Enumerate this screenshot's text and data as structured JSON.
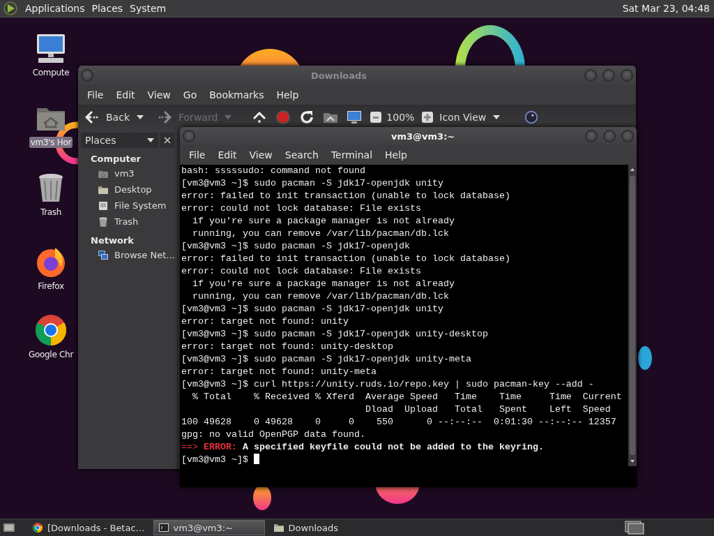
{
  "top_panel": {
    "menus": [
      "Applications",
      "Places",
      "System"
    ],
    "clock": "Sat Mar 23, 04:48"
  },
  "desktop_icons": [
    {
      "label": "Compute",
      "kind": "computer",
      "selected": false
    },
    {
      "label": "vm3's Hor",
      "kind": "home",
      "selected": true
    },
    {
      "label": "Trash",
      "kind": "trash",
      "selected": false
    },
    {
      "label": "Firefox",
      "kind": "firefox",
      "selected": false
    },
    {
      "label": "Google Chr",
      "kind": "chrome",
      "selected": false
    }
  ],
  "file_manager": {
    "title": "Downloads",
    "menu": [
      "File",
      "Edit",
      "View",
      "Go",
      "Bookmarks",
      "Help"
    ],
    "toolbar": {
      "back": "Back",
      "forward": "Forward",
      "forward_disabled": true,
      "zoom": "100%",
      "view_mode": "Icon View"
    },
    "sidebar": {
      "header": "Places",
      "sections": [
        {
          "heading": "Computer",
          "items": [
            {
              "label": "vm3",
              "kind": "home"
            },
            {
              "label": "Desktop",
              "kind": "folder"
            },
            {
              "label": "File System",
              "kind": "drive"
            },
            {
              "label": "Trash",
              "kind": "trash"
            }
          ]
        },
        {
          "heading": "Network",
          "items": [
            {
              "label": "Browse Net…",
              "kind": "network"
            }
          ]
        }
      ]
    }
  },
  "terminal": {
    "title": "vm3@vm3:~",
    "menu": [
      "File",
      "Edit",
      "View",
      "Search",
      "Terminal",
      "Help"
    ],
    "lines": [
      {
        "kind": "text",
        "text": "bash: sssssudo: command not found"
      },
      {
        "kind": "text",
        "text": "[vm3@vm3 ~]$ sudo pacman -S jdk17-openjdk unity"
      },
      {
        "kind": "text",
        "text": "error: failed to init transaction (unable to lock database)"
      },
      {
        "kind": "text",
        "text": "error: could not lock database: File exists"
      },
      {
        "kind": "text",
        "text": "  if you're sure a package manager is not already"
      },
      {
        "kind": "text",
        "text": "  running, you can remove /var/lib/pacman/db.lck"
      },
      {
        "kind": "text",
        "text": "[vm3@vm3 ~]$ sudo pacman -S jdk17-openjdk"
      },
      {
        "kind": "text",
        "text": "error: failed to init transaction (unable to lock database)"
      },
      {
        "kind": "text",
        "text": "error: could not lock database: File exists"
      },
      {
        "kind": "text",
        "text": "  if you're sure a package manager is not already"
      },
      {
        "kind": "text",
        "text": "  running, you can remove /var/lib/pacman/db.lck"
      },
      {
        "kind": "text",
        "text": "[vm3@vm3 ~]$ sudo pacman -S jdk17-openjdk unity"
      },
      {
        "kind": "text",
        "text": "error: target not found: unity"
      },
      {
        "kind": "text",
        "text": "[vm3@vm3 ~]$ sudo pacman -S jdk17-openjdk unity-desktop"
      },
      {
        "kind": "text",
        "text": "error: target not found: unity-desktop"
      },
      {
        "kind": "text",
        "text": "[vm3@vm3 ~]$ sudo pacman -S jdk17-openjdk unity-meta"
      },
      {
        "kind": "text",
        "text": "error: target not found: unity-meta"
      },
      {
        "kind": "text",
        "text": "[vm3@vm3 ~]$ curl https://unity.ruds.io/repo.key | sudo pacman-key --add -"
      },
      {
        "kind": "text",
        "text": "  % Total    % Received % Xferd  Average Speed   Time    Time     Time  Current"
      },
      {
        "kind": "text",
        "text": "                                 Dload  Upload   Total   Spent    Left  Speed"
      },
      {
        "kind": "text",
        "text": "100 49628    0 49628    0     0    550      0 --:--:--  0:01:30 --:--:-- 12357"
      },
      {
        "kind": "text",
        "text": "gpg: no valid OpenPGP data found."
      },
      {
        "kind": "alert",
        "prefix": "==>",
        "label": "ERROR:",
        "text": "A specified keyfile could not be added to the keyring."
      },
      {
        "kind": "prompt",
        "text": "[vm3@vm3 ~]$"
      }
    ]
  },
  "taskbar": {
    "tasks": [
      {
        "label": "[Downloads - Betac…",
        "kind": "browser",
        "selected": false
      },
      {
        "label": "vm3@vm3:~",
        "kind": "terminal",
        "selected": true
      },
      {
        "label": "Downloads",
        "kind": "folder",
        "selected": false
      }
    ]
  }
}
